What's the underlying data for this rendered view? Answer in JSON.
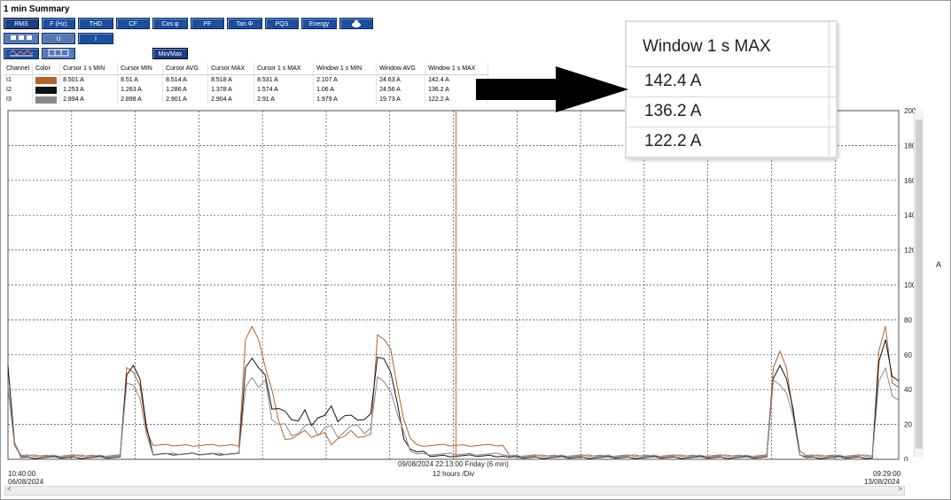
{
  "window": {
    "title": "1 min Summary"
  },
  "toolbar": {
    "row1": [
      "RMS",
      "F (Hz)",
      "THD",
      "CF",
      "Cos φ",
      "PF",
      "Tan Φ",
      "PQS",
      "Energy"
    ],
    "row2_u": "U",
    "row2_i": "I",
    "minmax": "Min/Max"
  },
  "table": {
    "headers": [
      "Channel",
      "Color",
      "Cursor 1 s MIN",
      "Cursor MIN",
      "Cursor AVG",
      "Cursor MAX",
      "Cursor 1 s MAX",
      "Window 1 s MIN",
      "Window AVG",
      "Window 1 s MAX"
    ],
    "rows": [
      {
        "channel": "I1",
        "color": "#b5622b",
        "values": [
          "8.501 A",
          "8.51 A",
          "8.514 A",
          "8.518 A",
          "8.531 A",
          "2.107 A",
          "24.63 A",
          "142.4 A"
        ]
      },
      {
        "channel": "I2",
        "color": "#111111",
        "values": [
          "1.253 A",
          "1.263 A",
          "1.286 A",
          "1.378 A",
          "1.574 A",
          "1.06 A",
          "24.56 A",
          "136.2 A"
        ]
      },
      {
        "channel": "I3",
        "color": "#8a8a8a",
        "values": [
          "2.894 A",
          "2.898 A",
          "2.901 A",
          "2.904 A",
          "2.91 A",
          "1.979 A",
          "19.73 A",
          "122.2 A"
        ]
      }
    ]
  },
  "zoom_callout": {
    "header": "Window 1 s MAX",
    "values": [
      "142.4 A",
      "136.2 A",
      "122.2 A"
    ]
  },
  "chart_data": {
    "type": "line",
    "y_ticks": [
      "200",
      "180",
      "160",
      "140",
      "120",
      "100",
      "80",
      "60",
      "40",
      "20",
      "0"
    ],
    "ylim": [
      0,
      200
    ],
    "y_unit": "A",
    "cursor_label": "09/08/2024 22:13:00 Friday (6 min)",
    "x_scale": "12 hours /Div",
    "x_start": {
      "time": "10:40:00",
      "date": "06/08/2024"
    },
    "x_end": {
      "time": "09:29:00",
      "date": "13/08/2024"
    },
    "series": [
      {
        "name": "I1",
        "color": "#b5622b",
        "y": [
          45,
          8,
          2,
          2,
          2,
          2,
          2,
          2,
          2,
          2,
          2,
          2,
          2,
          2,
          2,
          2,
          2,
          2,
          55,
          50,
          40,
          20,
          8,
          8,
          8,
          8,
          8,
          8,
          8,
          8,
          8,
          8,
          8,
          8,
          8,
          8,
          70,
          75,
          65,
          55,
          40,
          20,
          15,
          13,
          13,
          13,
          15,
          14,
          13,
          12,
          13,
          12,
          13,
          15,
          13,
          12,
          75,
          70,
          62,
          38,
          25,
          12,
          8,
          8,
          8,
          8,
          8,
          8,
          8,
          8,
          8,
          8,
          8,
          8,
          8,
          8,
          2,
          2,
          2,
          2,
          2,
          2,
          2,
          2,
          2,
          2,
          2,
          2,
          2,
          2,
          2,
          2,
          2,
          2,
          2,
          2,
          2,
          2,
          2,
          2,
          2,
          2,
          2,
          2,
          2,
          2,
          2,
          2,
          2,
          2,
          2,
          2,
          2,
          2,
          2,
          2,
          55,
          62,
          50,
          30,
          5,
          2,
          2,
          2,
          2,
          2,
          2,
          2,
          2,
          2,
          2,
          2,
          60,
          80,
          45,
          40
        ]
      },
      {
        "name": "I2",
        "color": "#111111",
        "y": [
          50,
          12,
          1,
          1,
          1,
          1,
          1,
          1,
          1,
          1,
          1,
          1,
          1,
          1,
          1,
          1,
          1,
          1,
          52,
          55,
          45,
          15,
          3,
          3,
          3,
          3,
          3,
          3,
          3,
          3,
          3,
          3,
          3,
          3,
          3,
          3,
          55,
          58,
          50,
          52,
          30,
          28,
          24,
          25,
          22,
          26,
          23,
          25,
          24,
          27,
          24,
          25,
          23,
          26,
          24,
          25,
          55,
          60,
          50,
          30,
          15,
          6,
          4,
          4,
          2,
          2,
          2,
          2,
          2,
          2,
          2,
          2,
          2,
          2,
          2,
          2,
          1,
          1,
          1,
          1,
          1,
          1,
          1,
          1,
          1,
          1,
          1,
          1,
          1,
          1,
          1,
          1,
          1,
          1,
          1,
          1,
          1,
          1,
          1,
          1,
          1,
          1,
          1,
          1,
          1,
          1,
          1,
          1,
          1,
          1,
          1,
          1,
          1,
          1,
          1,
          1,
          50,
          55,
          45,
          25,
          3,
          1,
          1,
          1,
          1,
          1,
          1,
          1,
          1,
          1,
          1,
          1,
          55,
          65,
          50,
          45
        ]
      },
      {
        "name": "I3",
        "color": "#8a8a8a",
        "y": [
          40,
          10,
          2,
          2,
          2,
          2,
          2,
          2,
          2,
          2,
          2,
          2,
          2,
          2,
          2,
          2,
          2,
          2,
          40,
          45,
          35,
          12,
          3,
          3,
          3,
          3,
          3,
          3,
          3,
          3,
          3,
          3,
          3,
          3,
          3,
          3,
          45,
          48,
          40,
          42,
          25,
          20,
          18,
          17,
          16,
          18,
          17,
          16,
          18,
          17,
          16,
          17,
          18,
          16,
          17,
          18,
          45,
          48,
          40,
          25,
          12,
          5,
          3,
          3,
          3,
          3,
          3,
          3,
          3,
          3,
          3,
          3,
          3,
          3,
          3,
          3,
          2,
          2,
          2,
          2,
          2,
          2,
          2,
          2,
          2,
          2,
          2,
          2,
          2,
          2,
          2,
          2,
          2,
          2,
          2,
          2,
          2,
          2,
          2,
          2,
          2,
          2,
          2,
          2,
          2,
          2,
          2,
          2,
          2,
          2,
          2,
          2,
          2,
          2,
          2,
          2,
          42,
          45,
          38,
          22,
          3,
          2,
          2,
          2,
          2,
          2,
          2,
          2,
          2,
          2,
          2,
          2,
          45,
          50,
          40,
          35
        ]
      }
    ]
  }
}
